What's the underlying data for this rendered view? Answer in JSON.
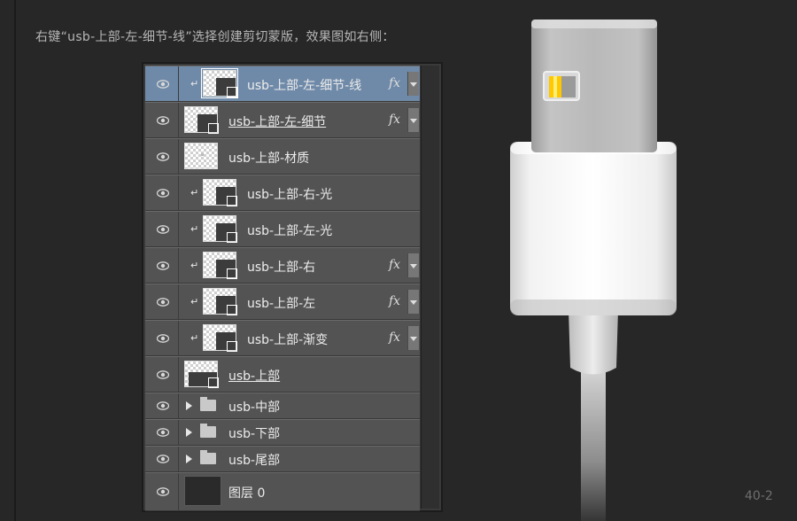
{
  "instruction": "右键“usb-上部-左-细节-线”选择创建剪切蒙版，效果图如右侧：",
  "page_number": "40-2",
  "layers": [
    {
      "name": "usb-上部-左-细节-线",
      "clipped": true,
      "fx": true,
      "selected": true,
      "thumb": "shape-mask",
      "underline": false
    },
    {
      "name": "usb-上部-左-细节",
      "clipped": false,
      "fx": true,
      "selected": false,
      "thumb": "shape-mask",
      "underline": true
    },
    {
      "name": "usb-上部-材质",
      "clipped": false,
      "fx": false,
      "selected": false,
      "thumb": "dot",
      "underline": false
    },
    {
      "name": "usb-上部-右-光",
      "clipped": true,
      "fx": false,
      "selected": false,
      "thumb": "shape-mask",
      "underline": false
    },
    {
      "name": "usb-上部-左-光",
      "clipped": true,
      "fx": false,
      "selected": false,
      "thumb": "shape-mask",
      "underline": false
    },
    {
      "name": "usb-上部-右",
      "clipped": true,
      "fx": true,
      "selected": false,
      "thumb": "shape-mask",
      "underline": false
    },
    {
      "name": "usb-上部-左",
      "clipped": true,
      "fx": true,
      "selected": false,
      "thumb": "shape-mask",
      "underline": false
    },
    {
      "name": "usb-上部-渐变",
      "clipped": true,
      "fx": true,
      "selected": false,
      "thumb": "shape-mask",
      "underline": false
    },
    {
      "name": "usb-上部",
      "clipped": false,
      "fx": false,
      "selected": false,
      "thumb": "shape-mask",
      "underline": true
    }
  ],
  "groups": [
    {
      "name": "usb-中部"
    },
    {
      "name": "usb-下部"
    },
    {
      "name": "usb-尾部"
    }
  ],
  "background_layer": {
    "name": "图层 0"
  },
  "fx_label": "fx",
  "clip_glyph": "↵",
  "colors": {
    "selected_row": "#6f8aa8",
    "row": "#535353",
    "canvas": "#272727"
  }
}
